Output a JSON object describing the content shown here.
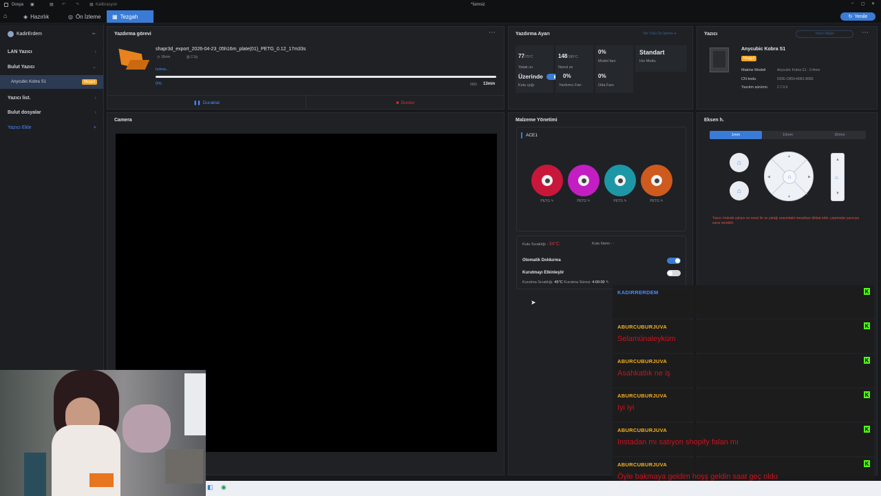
{
  "titlebar": {
    "menu": "Dosya",
    "file": "Kalibrasyon",
    "title": "*İsimsiz",
    "refresh_label": "Yenile"
  },
  "tabs": [
    {
      "label": "Hazırlık"
    },
    {
      "label": "Ön İzleme"
    },
    {
      "label": "Tezgah"
    }
  ],
  "sidebar": {
    "user": "KadirErdem",
    "items": [
      {
        "label": "LAN Yazıcı"
      },
      {
        "label": "Bulut Yazıcı"
      },
      {
        "label": "Yazıcı list."
      },
      {
        "label": "Bulut dosyalar"
      },
      {
        "label": "Yazıcı Ekle"
      }
    ],
    "printer": {
      "name": "Anycubic Kobra S1",
      "badge": "Meşgul"
    }
  },
  "job": {
    "title": "Yazdırma görevi",
    "filename": "shapr3d_export_2026-04-23_05h16m_plate(01)_PETG_0.12_17m33s",
    "time": "18min",
    "weight": "2.2g",
    "status": "Isıtma...",
    "progress_pct": "0%",
    "progress": 0,
    "layers": "0/83",
    "remaining": "13min",
    "pause_label": "Duraklat",
    "stop_label": "Durdur"
  },
  "camera": {
    "title": "Camera"
  },
  "settings": {
    "title": "Yazdırma Ayarı",
    "link": "Tek Tıkla Ön İşleme",
    "bed": {
      "value": "77",
      "target": "/75°C",
      "label": "Yatak ısı"
    },
    "nozzle": {
      "value": "148",
      "target": "/185°C",
      "label": "Nozul ısı"
    },
    "model_fan": {
      "value": "0%",
      "label": "Model fanı"
    },
    "speed": {
      "value": "Standart",
      "label": "Hız Modu"
    },
    "light": {
      "value": "Üzerinde",
      "label": "Kutu ışığı"
    },
    "aux_fan": {
      "value": "0%",
      "label": "Yardımcı Fan"
    },
    "chamber_fan": {
      "value": "0%",
      "label": "Oda Fanı"
    }
  },
  "printer": {
    "title": "Yazıcı",
    "link": "Yazıcı bilgisi",
    "name": "Anycubic Kobra S1",
    "badge": "Meşgul",
    "model_label": "Makine Modeli",
    "model": "Anycubic Kobra S1 - 0.4mm",
    "cn_label": "CN kodu",
    "cn": "520E-CB59-A6B1-8683",
    "fw_label": "Yazılım sürümü",
    "fw": "2.7.0.9"
  },
  "material": {
    "title": "Malzeme Yönetimi",
    "unit": "ACE1",
    "slots": [
      {
        "type": "PETG",
        "color": "#c8173a"
      },
      {
        "type": "PETG",
        "color": "#c21ec2"
      },
      {
        "type": "PETG",
        "color": "#1d97a5"
      },
      {
        "type": "PETG",
        "color": "#cf5a1e"
      }
    ],
    "box_temp_label": "Kutu Sıcaklığı :",
    "box_temp": "34°C",
    "box_hum_label": "Kutu Nemi :",
    "box_hum": "-",
    "auto_refill": "Otomatik Doldurma",
    "drying": "Kurutmayı Etkinleştir",
    "dry_temp_label": "Kurutma Sıcaklığı:",
    "dry_temp": "45°C",
    "dry_time_label": "Kurutma Süresi:",
    "dry_time": "4:00:00"
  },
  "axis": {
    "title": "Eksen h.",
    "steps": [
      "1mm",
      "10mm",
      "30mm"
    ],
    "warning": "Yazıcı önünde çalışın ve nozul ile ısı yatağı arasındaki mesafeye dikkat edin; çarpmalar yazıcıya zarar verebilir."
  },
  "chat": [
    {
      "name": "KADIRRERDEM",
      "msg": "",
      "name_color": "#4a8cff"
    },
    {
      "name": "ABURCUBURJUVA",
      "msg": "Selamünaleyküm"
    },
    {
      "name": "ABURCUBURJUVA",
      "msg": "Asahkatlık ne iş"
    },
    {
      "name": "ABURCUBURJUVA",
      "msg": "Iyi iyi"
    },
    {
      "name": "ABURCUBURJUVA",
      "msg": "Instadan mı satıyon shopify falan mı"
    },
    {
      "name": "ABURCUBURJUVA",
      "msg": "Öyle bakmaya geldim hoşş geldin saat geç oldu"
    }
  ],
  "colors": {
    "accent": "#3a7bd5",
    "danger": "#e0303a",
    "badge": "#f5a623",
    "kick": "#53fc18"
  }
}
